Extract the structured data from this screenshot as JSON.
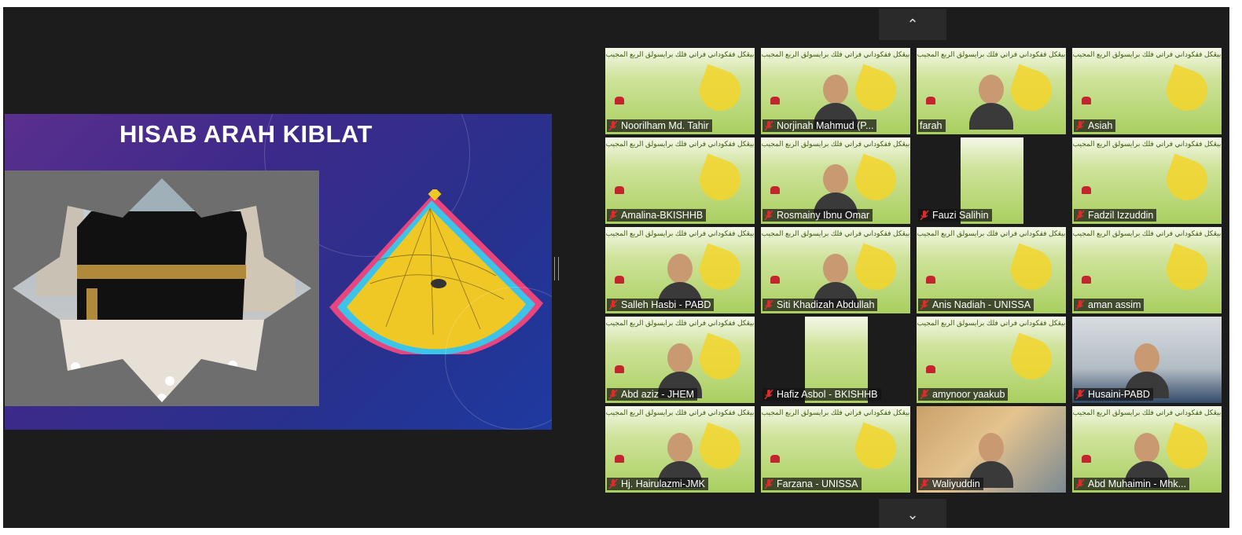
{
  "slide": {
    "title": "HISAB ARAH KIBLAT"
  },
  "navigation": {
    "up_icon": "chevron-up-icon",
    "down_icon": "chevron-down-icon",
    "up_glyph": "⌃",
    "down_glyph": "⌄"
  },
  "tile_header_text": "بيڠكل فقكوداني فراتي فلك برايسولق الربع المجيب",
  "participants": [
    {
      "name": "Noorilham Md. Tahir",
      "muted": true,
      "video": "slide"
    },
    {
      "name": "Norjinah Mahmud (P...",
      "muted": true,
      "video": "person"
    },
    {
      "name": "farah",
      "muted": false,
      "video": "person"
    },
    {
      "name": "Asiah",
      "muted": true,
      "video": "slide"
    },
    {
      "name": "Amalina-BKISHHB",
      "muted": true,
      "video": "slide"
    },
    {
      "name": "Rosmainy Ibnu Omar",
      "muted": true,
      "video": "person"
    },
    {
      "name": "Fauzi Salihin",
      "muted": true,
      "video": "cropped"
    },
    {
      "name": "Fadzil Izzuddin",
      "muted": true,
      "video": "slide"
    },
    {
      "name": "Salleh Hasbi - PABD",
      "muted": true,
      "video": "person"
    },
    {
      "name": "Siti Khadizah Abdullah",
      "muted": true,
      "video": "person"
    },
    {
      "name": "Anis Nadiah - UNISSA",
      "muted": true,
      "video": "slide"
    },
    {
      "name": "aman assim",
      "muted": true,
      "video": "slide"
    },
    {
      "name": "Abd aziz - JHEM",
      "muted": true,
      "video": "person"
    },
    {
      "name": "Hafiz Asbol - BKISHHB",
      "muted": true,
      "video": "cropped"
    },
    {
      "name": "amynoor yaakub",
      "muted": true,
      "video": "slide"
    },
    {
      "name": "Husaini-PABD",
      "muted": true,
      "video": "photo2"
    },
    {
      "name": "Hj. Hairulazmi-JMK",
      "muted": true,
      "video": "person"
    },
    {
      "name": "Farzana - UNISSA",
      "muted": true,
      "video": "slide"
    },
    {
      "name": "Waliyuddin",
      "muted": true,
      "video": "photo"
    },
    {
      "name": "Abd Muhaimin - Mhk...",
      "muted": true,
      "video": "person"
    }
  ],
  "colors": {
    "background": "#1c1c1c",
    "tile_green": "#a9cf5f",
    "mute_red": "#e02b2b",
    "nameplate": "#141414"
  }
}
